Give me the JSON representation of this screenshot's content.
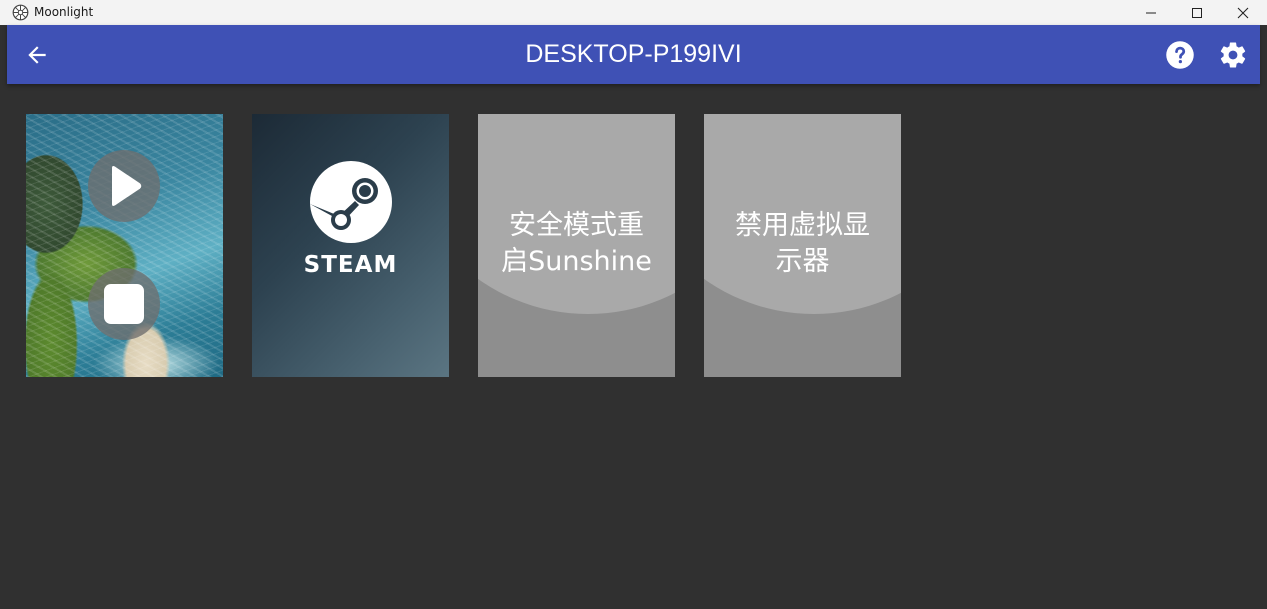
{
  "window": {
    "title": "Moonlight",
    "icon": "moonlight-logo-icon",
    "controls": [
      "minimize-icon",
      "maximize-icon",
      "close-icon"
    ]
  },
  "appbar": {
    "title": "DESKTOP-P199IVI",
    "back_icon": "arrow-back-icon",
    "help_icon": "help-icon",
    "settings_icon": "gear-icon",
    "color": "#3f51b5"
  },
  "apps": [
    {
      "id": "running-app",
      "running": true,
      "artwork": "coastline-photo",
      "actions": [
        "play-icon",
        "stop-icon"
      ]
    },
    {
      "id": "steam",
      "label": "STEAM",
      "artwork": "steam-logo-icon"
    },
    {
      "id": "safe-mode-restart",
      "label": "安全模式重启Sunshine",
      "line1": "安全模式重",
      "line2": "启Sunshine"
    },
    {
      "id": "disable-virtual-display",
      "label": "禁用虚拟显示器",
      "line1": "禁用虚拟显",
      "line2": "示器"
    }
  ],
  "colors": {
    "background": "#303030",
    "titlebar": "#f3f3f3",
    "tile_generic": "#8e8e8e"
  }
}
